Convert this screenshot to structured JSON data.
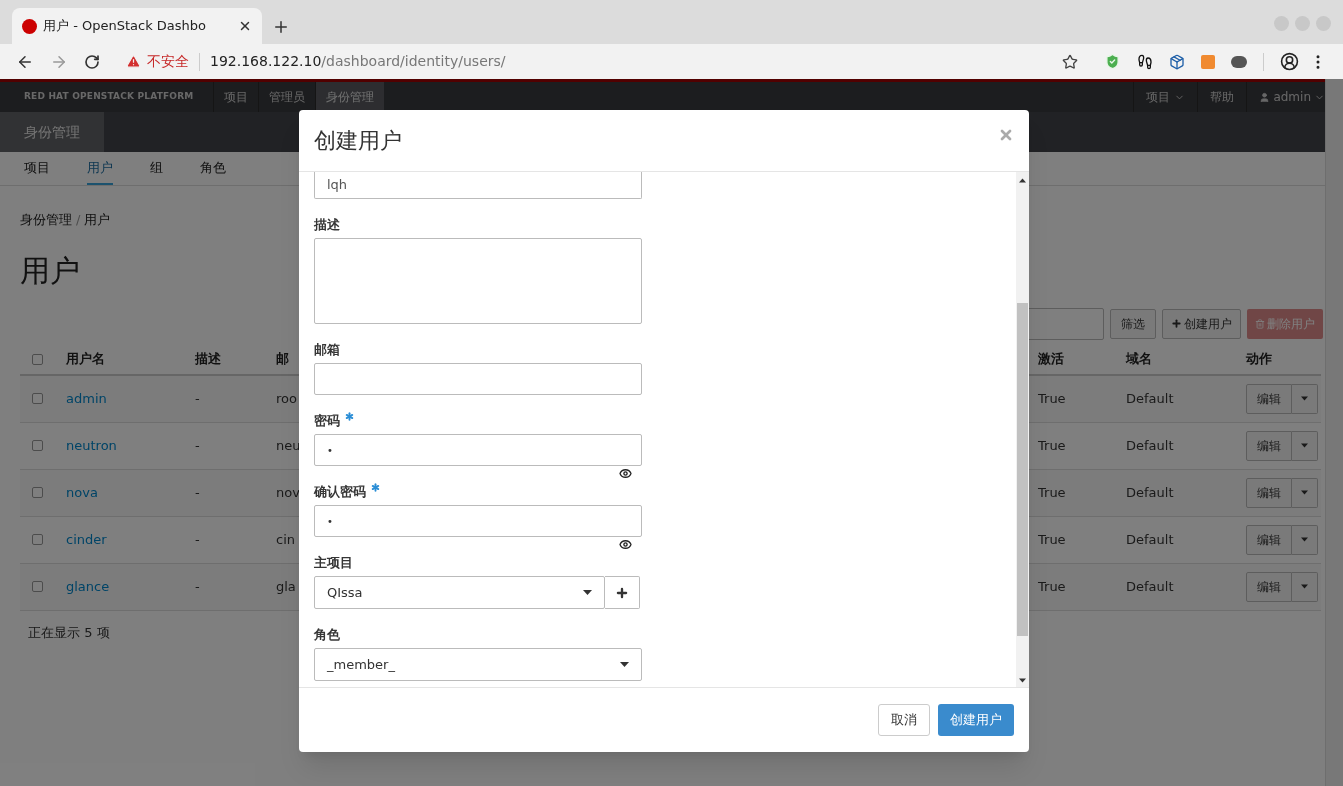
{
  "browser": {
    "tab_title": "用户 - OpenStack Dashbo",
    "security_label": "不安全",
    "url_host": "192.168.122.10",
    "url_path": "/dashboard/identity/users/"
  },
  "top_nav": {
    "brand": "RED HAT OPENSTACK PLATFORM",
    "items": [
      {
        "label": "项目",
        "selected": false
      },
      {
        "label": "管理员",
        "selected": false
      },
      {
        "label": "身份管理",
        "selected": true
      }
    ],
    "project_menu": "项目",
    "help": "帮助",
    "user": "admin"
  },
  "panel_tab": "身份管理",
  "sub_tabs": [
    {
      "label": "项目",
      "selected": false
    },
    {
      "label": "用户",
      "selected": true
    },
    {
      "label": "组",
      "selected": false
    },
    {
      "label": "角色",
      "selected": false
    }
  ],
  "breadcrumb": [
    "身份管理",
    "用户"
  ],
  "breadcrumb_separator": "/",
  "page_title": "用户",
  "toolbar": {
    "filter_button": "筛选",
    "create_button": "创建用户",
    "delete_button": {
      "label": "删除用户",
      "disabled": true
    }
  },
  "table": {
    "header_checked": false,
    "columns": [
      "用户名",
      "描述",
      "邮",
      "激活",
      "域名",
      "动作"
    ],
    "rows": [
      {
        "checked": false,
        "name": "admin",
        "description": "-",
        "email": "roo",
        "enabled": "True",
        "domain": "Default",
        "action": "编辑"
      },
      {
        "checked": false,
        "name": "neutron",
        "description": "-",
        "email": "neu",
        "enabled": "True",
        "domain": "Default",
        "action": "编辑"
      },
      {
        "checked": false,
        "name": "nova",
        "description": "-",
        "email": "nov",
        "enabled": "True",
        "domain": "Default",
        "action": "编辑"
      },
      {
        "checked": false,
        "name": "cinder",
        "description": "-",
        "email": "cin",
        "enabled": "True",
        "domain": "Default",
        "action": "编辑"
      },
      {
        "checked": false,
        "name": "glance",
        "description": "-",
        "email": "gla",
        "enabled": "True",
        "domain": "Default",
        "action": "编辑"
      }
    ],
    "footer": "正在显示 5 项"
  },
  "modal": {
    "title": "创建用户",
    "fields": [
      {
        "kind": "input",
        "value": "lqh"
      },
      {
        "kind": "textarea",
        "label": "描述"
      },
      {
        "kind": "input",
        "label": "邮箱"
      },
      {
        "kind": "password",
        "label": "密码",
        "required": true,
        "value": "•"
      },
      {
        "kind": "password",
        "label": "确认密码",
        "required": true,
        "value": "•"
      },
      {
        "kind": "select",
        "label": "主项目",
        "value": "QIssa",
        "add_button": true
      },
      {
        "kind": "select",
        "label": "角色",
        "value": "_member_"
      }
    ],
    "cancel_button": "取消",
    "submit_button": "创建用户"
  }
}
